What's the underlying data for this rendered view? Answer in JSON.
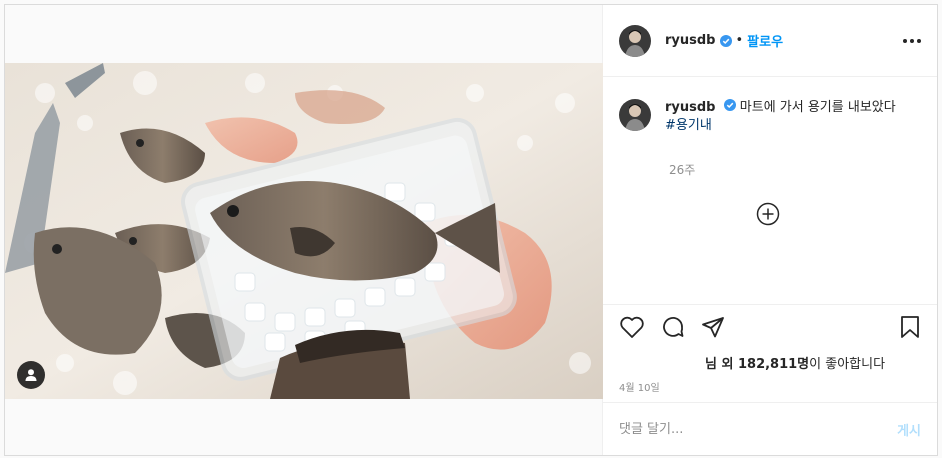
{
  "header": {
    "username": "ryusdb",
    "dot": "•",
    "follow_label": "팔로우"
  },
  "caption": {
    "username": "ryusdb",
    "text": "마트에 가서 용기를 내보았다 ",
    "hashtag": "#용기내",
    "age": "26주"
  },
  "engagement": {
    "likes_prefix": "님 외 182,811명",
    "likes_suffix": "이 좋아합니다",
    "date": "4월 10일"
  },
  "comment": {
    "placeholder": "댓글 달기...",
    "post_label": "게시"
  },
  "colors": {
    "accent": "#0095f6",
    "verified": "#3897f0",
    "post_disabled": "#b2dffc"
  }
}
